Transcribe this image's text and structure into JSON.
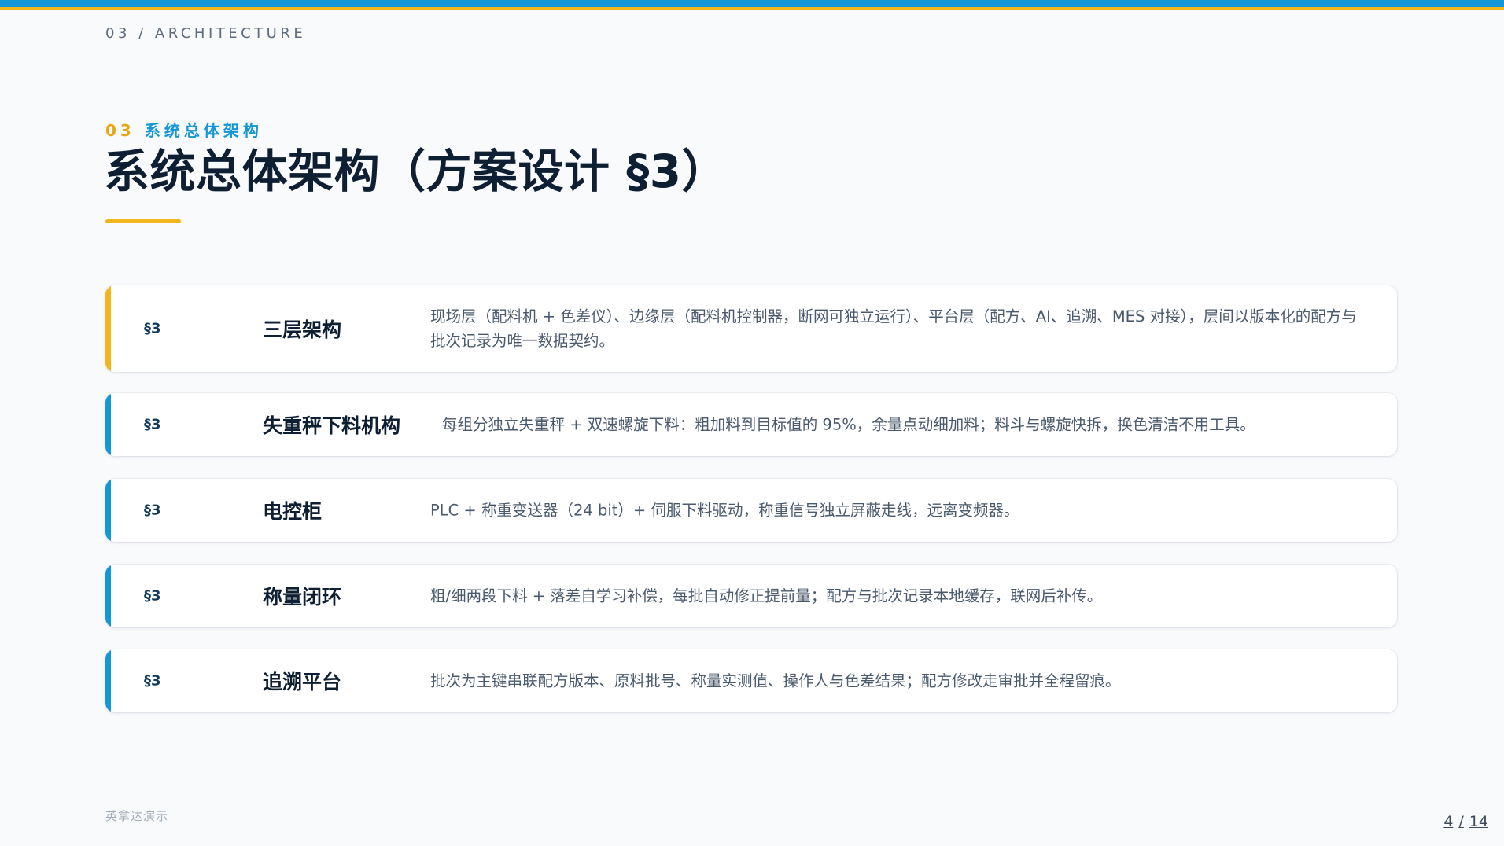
{
  "breadcrumb": "03 / ARCHITECTURE",
  "eyebrow": {
    "number": "03",
    "text": "系统总体架构"
  },
  "title": "系统总体架构（方案设计 §3）",
  "accent_colors": {
    "blue": "#1596d6",
    "yellow": "#f2b51c"
  },
  "sections": [
    {
      "tag": "§3",
      "name": "三层架构",
      "description": "现场层（配料机 + 色差仪）、边缘层（配料机控制器，断网可独立运行）、平台层（配方、AI、追溯、MES 对接），层间以版本化的配方与批次记录为唯一数据契约。",
      "accent": "#f2b51c"
    },
    {
      "tag": "§3",
      "name": "失重秤下料机构",
      "description": "每组分独立失重秤 + 双速螺旋下料：粗加料到目标值的 95%，余量点动细加料；料斗与螺旋快拆，换色清洁不用工具。",
      "accent": "#1596d6"
    },
    {
      "tag": "§3",
      "name": "电控柜",
      "description": "PLC + 称重变送器（24 bit）+ 伺服下料驱动，称重信号独立屏蔽走线，远离变频器。",
      "accent": "#1596d6"
    },
    {
      "tag": "§3",
      "name": "称量闭环",
      "description": "粗/细两段下料 + 落差自学习补偿，每批自动修正提前量；配方与批次记录本地缓存，联网后补传。",
      "accent": "#1596d6"
    },
    {
      "tag": "§3",
      "name": "追溯平台",
      "description": "批次为主键串联配方版本、原料批号、称量实测值、操作人与色差结果；配方修改走审批并全程留痕。",
      "accent": "#1596d6"
    }
  ],
  "footer": {
    "brand": "英拿达演示"
  },
  "pager": {
    "current": "4",
    "separator": "/",
    "total": "14"
  }
}
